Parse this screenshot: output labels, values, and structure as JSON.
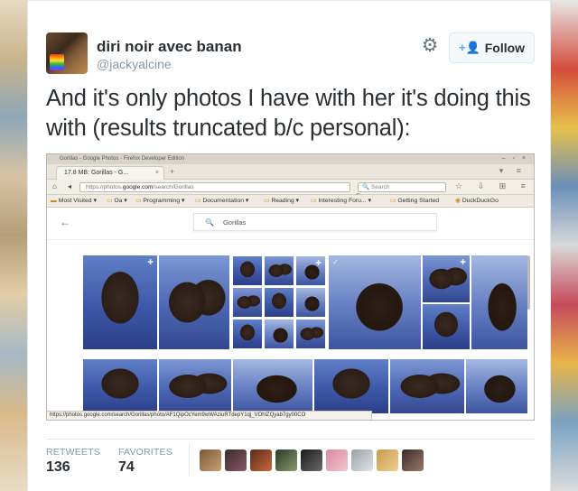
{
  "tweet": {
    "user_name": "diri noir avec banan",
    "user_handle": "@jackyalcine",
    "follow_label": "Follow",
    "follow_icon": "person-plus-icon",
    "settings_icon": "gear-icon",
    "text": "And it's only photos I have with her it's doing this with (results truncated b/c personal):",
    "stats": {
      "retweets_label": "RETWEETS",
      "retweets_value": "136",
      "favorites_label": "FAVORITES",
      "favorites_value": "74"
    },
    "favoriter_count_shown": 9
  },
  "embedded_screenshot": {
    "window_title": "Gorillas - Google Photos - Firefox Developer Edition",
    "tab_title": "17.8 MB: Gorillas - G...",
    "url_prefix": "https://photos.",
    "url_domain": "google.com",
    "url_path": "/search/Gorillas",
    "search_placeholder": "Search",
    "bookmarks": [
      "Most Visited",
      "Oa",
      "Programming",
      "Documentation",
      "Reading",
      "Interesting Foru...",
      "Getting Started",
      "DuckDuckGo"
    ],
    "photos_search_query": "Gorillas",
    "status_url": "https://photos.google.com/search/Gorillas/photo/AF1QipOcYem9wWAziuRTdepY1qj_VOhlZQyab7gy00CO"
  },
  "colors": {
    "follow_icon": "#55acee",
    "text_primary": "#292f33",
    "text_secondary": "#8899a6",
    "border": "#e1e8ed"
  }
}
